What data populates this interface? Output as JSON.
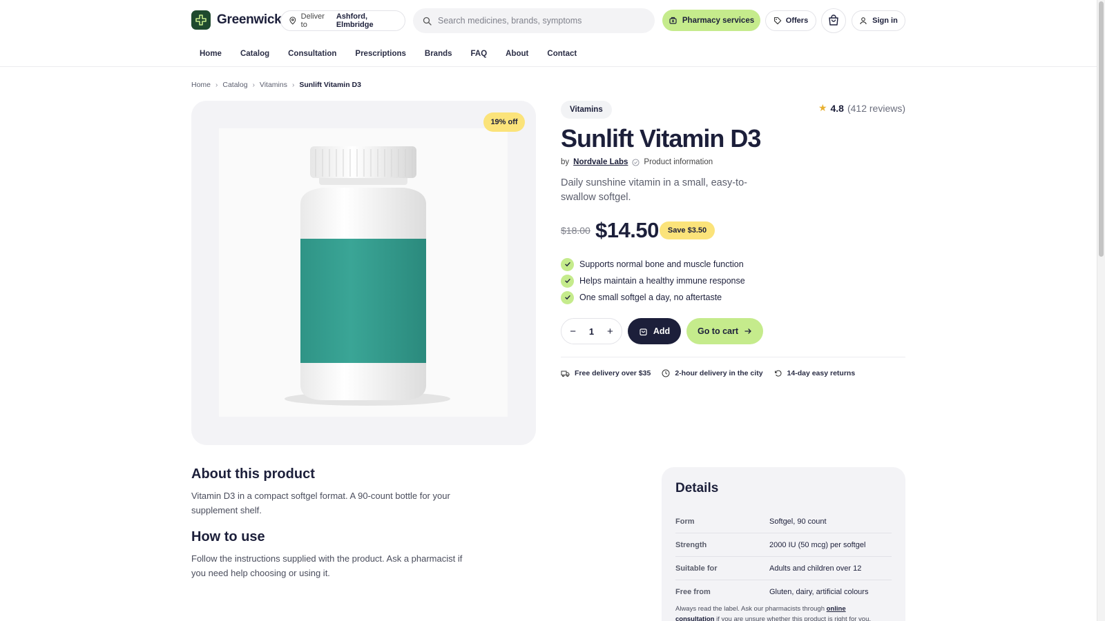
{
  "header": {
    "brand": "Greenwick",
    "deliver_label": "Deliver to",
    "deliver_location": "Ashford, Elmbridge",
    "search_placeholder": "Search medicines, brands, symptoms",
    "pharmacy_services": "Pharmacy services",
    "offers": "Offers",
    "sign_in": "Sign in",
    "accent_color": "#c5eb8c",
    "brand_color": "#1f4a2e"
  },
  "nav": [
    "Home",
    "Catalog",
    "Consultation",
    "Prescriptions",
    "Brands",
    "FAQ",
    "About",
    "Contact"
  ],
  "breadcrumb": [
    "Home",
    "Catalog",
    "Vitamins",
    "Sunlift Vitamin D3"
  ],
  "product": {
    "discount_badge": "19% off",
    "category": "Vitamins",
    "rating": "4.8",
    "reviews": "(412 reviews)",
    "name": "Sunlift Vitamin D3",
    "by": "by",
    "brand": "Nordvale Labs",
    "info_link": "Product information",
    "description": "Daily sunshine vitamin in a small, easy-to-swallow softgel.",
    "old_price": "$18.00",
    "price": "$14.50",
    "save": "Save $3.50",
    "benefits": [
      "Supports normal bone and muscle function",
      "Helps maintain a healthy immune response",
      "One small softgel a day, no aftertaste"
    ],
    "quantity": "1",
    "add_label": "Add",
    "goto_cart": "Go to cart",
    "perks": [
      "Free delivery over $35",
      "2-hour delivery in the city",
      "14-day easy returns"
    ]
  },
  "about": {
    "title": "About this product",
    "text": "Vitamin D3 in a compact softgel format. A 90-count bottle for your supplement shelf.",
    "howto_title": "How to use",
    "howto_text": "Follow the instructions supplied with the product. Ask a pharmacist if you need help choosing or using it."
  },
  "details": {
    "title": "Details",
    "rows": [
      {
        "k": "Form",
        "v": "Softgel, 90 count"
      },
      {
        "k": "Strength",
        "v": "2000 IU (50 mcg) per softgel"
      },
      {
        "k": "Suitable for",
        "v": "Adults and children over 12"
      },
      {
        "k": "Free from",
        "v": "Gluten, dairy, artificial colours"
      }
    ],
    "note_prefix": "Always read the label. Ask our pharmacists through",
    "note_link": "online consultation",
    "note_suffix": "if you are unsure whether this product is right for you."
  }
}
